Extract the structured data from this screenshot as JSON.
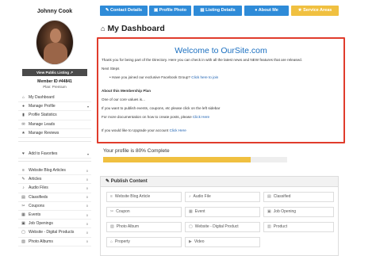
{
  "sidebar": {
    "user_name": "Johnny Cook",
    "view_public_listing": "View Public Listing ↗",
    "member_id": "Member ID #44841",
    "plan": "Plan: Premium",
    "menu_main": [
      {
        "icon": "⌂",
        "label": "My Dashboard",
        "caret": "",
        "badge": ""
      },
      {
        "icon": "●",
        "label": "Manage Profile",
        "caret": "▾",
        "badge": ""
      },
      {
        "icon": "▮",
        "label": "Profile Statistics",
        "caret": "",
        "badge": ""
      },
      {
        "icon": "✉",
        "label": "Manage Leads",
        "caret": "",
        "badge": ""
      },
      {
        "icon": "★",
        "label": "Manage Reviews",
        "caret": "",
        "badge": ""
      }
    ],
    "menu_fav": [
      {
        "icon": "♥",
        "label": "Add to Favorites",
        "caret": "▾",
        "badge": ""
      }
    ],
    "menu_posts": [
      {
        "icon": "≡",
        "label": "Website Blog Articles",
        "caret": "",
        "badge": "0"
      },
      {
        "icon": "✎",
        "label": "Articles",
        "caret": "",
        "badge": "0"
      },
      {
        "icon": "♪",
        "label": "Audio Files",
        "caret": "",
        "badge": "0"
      },
      {
        "icon": "▤",
        "label": "Classifieds",
        "caret": "",
        "badge": "0"
      },
      {
        "icon": "✂",
        "label": "Coupons",
        "caret": "",
        "badge": "0"
      },
      {
        "icon": "▦",
        "label": "Events",
        "caret": "",
        "badge": "0"
      },
      {
        "icon": "▣",
        "label": "Job Openings",
        "caret": "",
        "badge": "0"
      },
      {
        "icon": "▢",
        "label": "Website - Digital Products",
        "caret": "",
        "badge": "0"
      },
      {
        "icon": "▨",
        "label": "Photo Albums",
        "caret": "",
        "badge": "0"
      }
    ]
  },
  "tabs": [
    {
      "icon": "✎",
      "label": "Contact Details",
      "color": "#2e8bd8"
    },
    {
      "icon": "▣",
      "label": "Profile Photo",
      "color": "#2e8bd8"
    },
    {
      "icon": "▤",
      "label": "Listing Details",
      "color": "#2e8bd8"
    },
    {
      "icon": "●",
      "label": "About Me",
      "color": "#2e8bd8"
    },
    {
      "icon": "★",
      "label": "Service Areas",
      "color": "#f0c040"
    }
  ],
  "dashboard_title": "My Dashboard",
  "welcome": {
    "title": "Welcome to OurSite.com",
    "intro": "Thank you for being part of the Directory. Here you can check in with all the latest news and NEW features that are released.",
    "next_steps": "Next Steps",
    "bullet_text": "Have you joined our exclusive Facebook Group?",
    "bullet_link": "Click here to join",
    "plan_heading": "About this Membership Plan",
    "line1": "One of our core values is...",
    "line2": "If you want to publish events, coupons, etc please click on the left sidebar",
    "line3_text": "For more documentation on how to create posts, please",
    "line3_link": "Click Here",
    "line4_text": "If you would like to Upgrade your account",
    "line4_link": "Click Here"
  },
  "progress": {
    "label": "Your profile is 80% Complete",
    "percent": 80,
    "color": "#f0c040"
  },
  "publish": {
    "title": "Publish Content",
    "items": [
      {
        "icon": "≡",
        "label": "Website Blog Article"
      },
      {
        "icon": "♪",
        "label": "Audio File"
      },
      {
        "icon": "▤",
        "label": "Classified"
      },
      {
        "icon": "✂",
        "label": "Coupon"
      },
      {
        "icon": "▦",
        "label": "Event"
      },
      {
        "icon": "▣",
        "label": "Job Opening"
      },
      {
        "icon": "▨",
        "label": "Photo Album"
      },
      {
        "icon": "▢",
        "label": "Website - Digital Product"
      },
      {
        "icon": "▥",
        "label": "Product"
      },
      {
        "icon": "⌂",
        "label": "Property"
      },
      {
        "icon": "▶",
        "label": "Video"
      }
    ]
  }
}
